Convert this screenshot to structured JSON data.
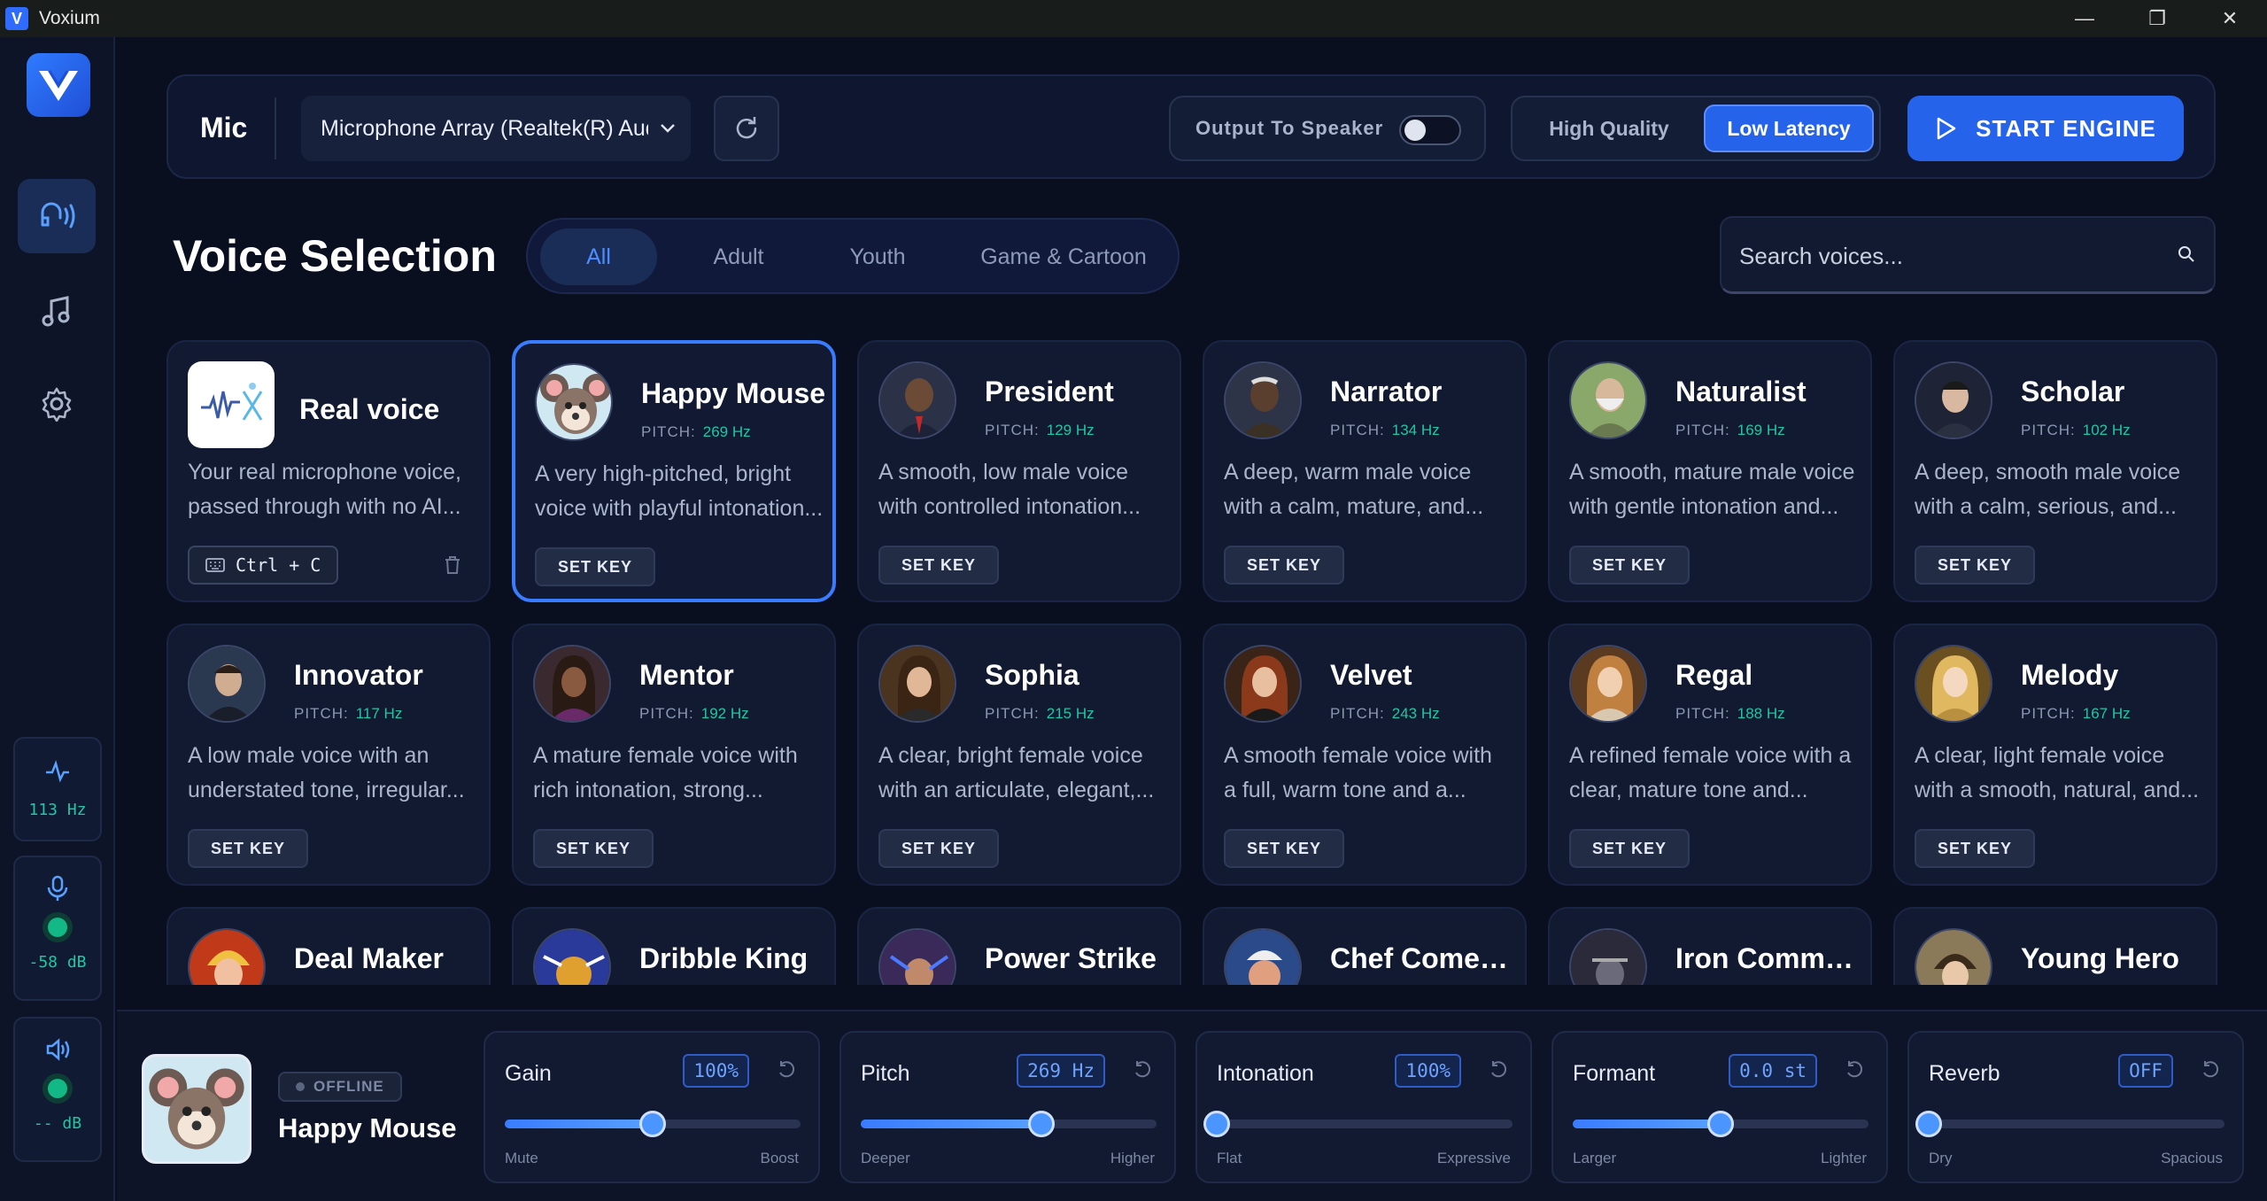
{
  "window": {
    "title": "Voxium"
  },
  "topbar": {
    "mic_label": "Mic",
    "mic_device": "Microphone Array (Realtek(R) Audio)",
    "output_label": "Output To Speaker",
    "quality_hq": "High Quality",
    "quality_ll": "Low Latency",
    "quality_selected": "Low Latency",
    "start_label": "START ENGINE"
  },
  "section": {
    "title": "Voice Selection",
    "tabs": [
      "All",
      "Adult",
      "Youth",
      "Game & Cartoon"
    ],
    "active_tab": "All",
    "search_placeholder": "Search voices..."
  },
  "voices": [
    {
      "name": "Real voice",
      "pitch_label": "",
      "pitch": "",
      "desc1": "Your real microphone voice,",
      "desc2": "passed through with no AI...",
      "hotkey": "Ctrl + C",
      "icon": "waveform-logo"
    },
    {
      "name": "Happy Mouse",
      "pitch_label": "PITCH:",
      "pitch": "269 Hz",
      "desc1": "A very high-pitched, bright",
      "desc2": "voice with playful intonation...",
      "key": "SET KEY"
    },
    {
      "name": "President",
      "pitch_label": "PITCH:",
      "pitch": "129 Hz",
      "desc1": "A smooth, low male voice",
      "desc2": "with controlled intonation...",
      "key": "SET KEY"
    },
    {
      "name": "Narrator",
      "pitch_label": "PITCH:",
      "pitch": "134 Hz",
      "desc1": "A deep, warm male voice",
      "desc2": "with a calm, mature, and...",
      "key": "SET KEY"
    },
    {
      "name": "Naturalist",
      "pitch_label": "PITCH:",
      "pitch": "169 Hz",
      "desc1": "A smooth, mature male voice",
      "desc2": "with gentle intonation and...",
      "key": "SET KEY"
    },
    {
      "name": "Scholar",
      "pitch_label": "PITCH:",
      "pitch": "102 Hz",
      "desc1": "A deep, smooth male voice",
      "desc2": "with a calm, serious, and...",
      "key": "SET KEY"
    },
    {
      "name": "Innovator",
      "pitch_label": "PITCH:",
      "pitch": "117 Hz",
      "desc1": "A low male voice with an",
      "desc2": "understated tone, irregular...",
      "key": "SET KEY"
    },
    {
      "name": "Mentor",
      "pitch_label": "PITCH:",
      "pitch": "192 Hz",
      "desc1": "A mature female voice with",
      "desc2": "rich intonation, strong...",
      "key": "SET KEY"
    },
    {
      "name": "Sophia",
      "pitch_label": "PITCH:",
      "pitch": "215 Hz",
      "desc1": "A clear, bright female voice",
      "desc2": "with an articulate, elegant,...",
      "key": "SET KEY"
    },
    {
      "name": "Velvet",
      "pitch_label": "PITCH:",
      "pitch": "243 Hz",
      "desc1": "A smooth female voice with",
      "desc2": "a full, warm tone and a...",
      "key": "SET KEY"
    },
    {
      "name": "Regal",
      "pitch_label": "PITCH:",
      "pitch": "188 Hz",
      "desc1": "A refined female voice with a",
      "desc2": "clear, mature tone and...",
      "key": "SET KEY"
    },
    {
      "name": "Melody",
      "pitch_label": "PITCH:",
      "pitch": "167 Hz",
      "desc1": "A clear, light female voice",
      "desc2": "with a smooth, natural, and...",
      "key": "SET KEY"
    },
    {
      "name": "Deal Maker"
    },
    {
      "name": "Dribble King"
    },
    {
      "name": "Power Strike"
    },
    {
      "name": "Chef Comedian"
    },
    {
      "name": "Iron Commander"
    },
    {
      "name": "Young Hero"
    }
  ],
  "sidebar_stats": {
    "pitch": "113 Hz",
    "mic_level": "-58 dB",
    "out_level": "-- dB"
  },
  "current": {
    "status": "OFFLINE",
    "name": "Happy Mouse"
  },
  "sliders": [
    {
      "label": "Gain",
      "value": "100%",
      "min": "Mute",
      "max": "Boost",
      "level": 0.5
    },
    {
      "label": "Pitch",
      "value": "269 Hz",
      "min": "Deeper",
      "max": "Higher",
      "level": 0.61
    },
    {
      "label": "Intonation",
      "value": "100%",
      "min": "Flat",
      "max": "Expressive",
      "level": 0.0
    },
    {
      "label": "Formant",
      "value": "0.0 st",
      "min": "Larger",
      "max": "Lighter",
      "level": 0.5
    },
    {
      "label": "Reverb",
      "value": "OFF",
      "min": "Dry",
      "max": "Spacious",
      "level": 0.0
    }
  ],
  "colors": {
    "accent": "#2563eb",
    "pitch": "#1fc7a4",
    "bg": "#0a0f1f"
  }
}
